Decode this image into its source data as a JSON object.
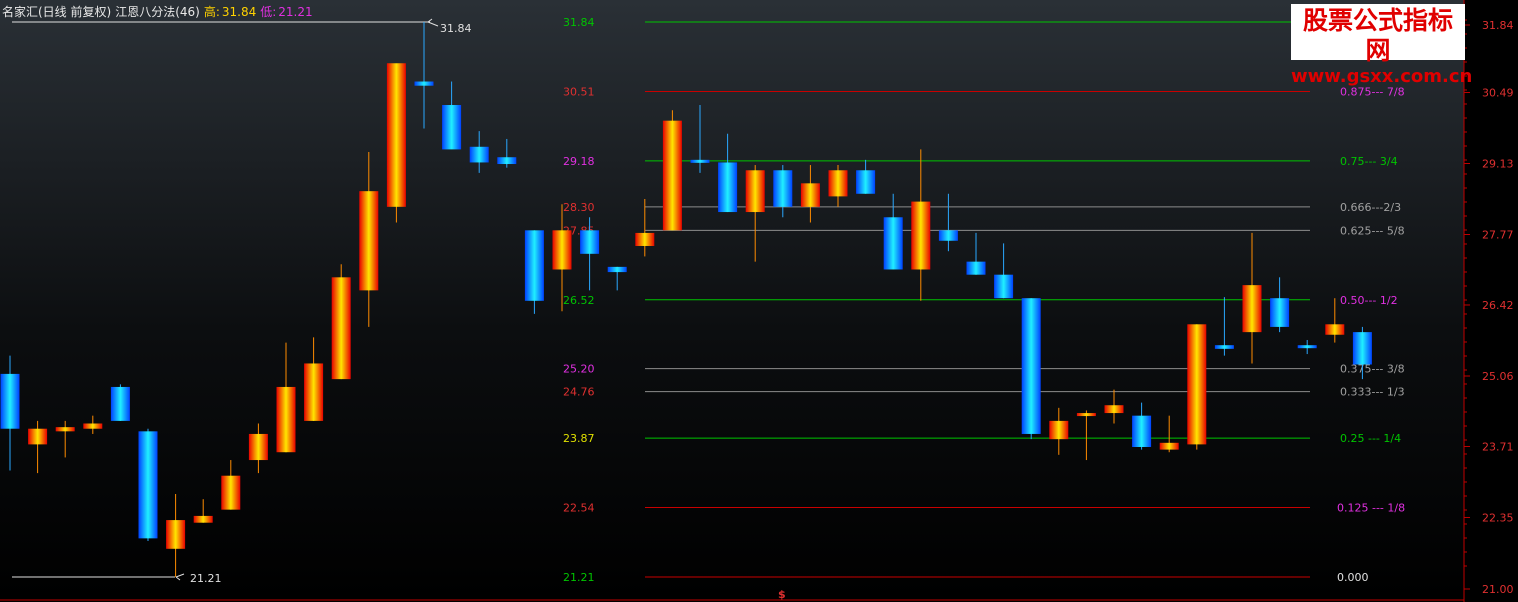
{
  "header": {
    "stock_name": "名家汇(日线 前复权)",
    "indicator": "江恩八分法(46)",
    "high_label": "高:",
    "high_value": "31.84",
    "low_label": "低:",
    "low_value": "21.21"
  },
  "watermark": {
    "line1": "股票公式指标网",
    "line2": "www.gsxx.com.cn"
  },
  "colors": {
    "background": "#000000",
    "up_candle": "#ff3a00",
    "down_candle": "#00a8ff",
    "green_level": "#00c400",
    "red_level": "#c80000",
    "gray_level": "#8c8c8c",
    "magenta_text": "#e030e0",
    "right_axis": "#c00000"
  },
  "chart_data": {
    "type": "candlestick",
    "title": "",
    "ylim": [
      21.0,
      31.84
    ],
    "y_axis_ticks": [
      "31.84",
      "30.49",
      "29.13",
      "27.77",
      "26.42",
      "25.06",
      "23.71",
      "22.35",
      "21.00"
    ],
    "y_axis_tick_values": [
      31.84,
      30.49,
      29.13,
      27.77,
      26.42,
      25.06,
      23.71,
      22.35,
      21.0
    ],
    "annotations": {
      "high": "31.84",
      "low": "21.21",
      "marker": "$"
    },
    "levels": [
      {
        "price": 31.84,
        "price_label": "31.84",
        "ratio_label": "",
        "color": "green",
        "style": "white_top"
      },
      {
        "price": 30.51,
        "price_label": "30.51",
        "ratio_label": "0.875--- 7/8",
        "color": "red"
      },
      {
        "price": 29.18,
        "price_label": "29.18",
        "ratio_label": "0.75--- 3/4",
        "color": "green"
      },
      {
        "price": 28.3,
        "price_label": "28.30",
        "ratio_label": "0.666---2/3",
        "color": "gray"
      },
      {
        "price": 27.85,
        "price_label": "27.85",
        "ratio_label": "0.625--- 5/8",
        "color": "gray"
      },
      {
        "price": 26.52,
        "price_label": "26.52",
        "ratio_label": "0.50--- 1/2",
        "color": "green"
      },
      {
        "price": 25.2,
        "price_label": "25.20",
        "ratio_label": "0.375--- 3/8",
        "color": "gray"
      },
      {
        "price": 24.76,
        "price_label": "24.76",
        "ratio_label": "0.333--- 1/3",
        "color": "gray"
      },
      {
        "price": 23.87,
        "price_label": "23.87",
        "ratio_label": "0.25 --- 1/4",
        "color": "green"
      },
      {
        "price": 22.54,
        "price_label": "22.54",
        "ratio_label": "0.125 --- 1/8",
        "color": "red"
      },
      {
        "price": 21.21,
        "price_label": "21.21",
        "ratio_label": "0.000",
        "color": "red"
      }
    ],
    "candles": [
      {
        "o": 25.1,
        "h": 25.45,
        "l": 23.25,
        "c": 24.05
      },
      {
        "o": 23.75,
        "h": 24.2,
        "l": 23.2,
        "c": 24.05
      },
      {
        "o": 24.0,
        "h": 24.2,
        "l": 23.5,
        "c": 24.08
      },
      {
        "o": 24.05,
        "h": 24.3,
        "l": 23.95,
        "c": 24.15
      },
      {
        "o": 24.85,
        "h": 24.9,
        "l": 24.2,
        "c": 24.2
      },
      {
        "o": 24.0,
        "h": 24.05,
        "l": 21.9,
        "c": 21.95
      },
      {
        "o": 21.75,
        "h": 22.8,
        "l": 21.21,
        "c": 22.3
      },
      {
        "o": 22.25,
        "h": 22.7,
        "l": 22.25,
        "c": 22.38
      },
      {
        "o": 22.5,
        "h": 23.45,
        "l": 22.5,
        "c": 23.15
      },
      {
        "o": 23.45,
        "h": 24.15,
        "l": 23.2,
        "c": 23.95
      },
      {
        "o": 23.6,
        "h": 25.7,
        "l": 23.6,
        "c": 24.85
      },
      {
        "o": 24.2,
        "h": 25.8,
        "l": 24.2,
        "c": 25.3
      },
      {
        "o": 25.0,
        "h": 27.2,
        "l": 25.0,
        "c": 26.95
      },
      {
        "o": 26.7,
        "h": 29.35,
        "l": 26.0,
        "c": 28.6
      },
      {
        "o": 28.3,
        "h": 31.0,
        "l": 28.0,
        "c": 31.05
      },
      {
        "o": 30.7,
        "h": 31.84,
        "l": 29.8,
        "c": 30.62
      },
      {
        "o": 30.25,
        "h": 30.7,
        "l": 29.65,
        "c": 29.4
      },
      {
        "o": 29.45,
        "h": 29.75,
        "l": 28.95,
        "c": 29.15
      },
      {
        "o": 29.25,
        "h": 29.6,
        "l": 29.05,
        "c": 29.12
      },
      {
        "o": 27.85,
        "h": 27.85,
        "l": 26.25,
        "c": 26.5
      },
      {
        "o": 27.1,
        "h": 28.35,
        "l": 26.3,
        "c": 27.85
      },
      {
        "o": 27.85,
        "h": 28.1,
        "l": 26.7,
        "c": 27.4
      },
      {
        "o": 27.15,
        "h": 27.15,
        "l": 26.7,
        "c": 27.05
      },
      {
        "o": 27.55,
        "h": 28.45,
        "l": 27.35,
        "c": 27.8
      },
      {
        "o": 27.85,
        "h": 30.15,
        "l": 27.85,
        "c": 29.95
      },
      {
        "o": 29.2,
        "h": 30.25,
        "l": 28.95,
        "c": 29.15
      },
      {
        "o": 29.15,
        "h": 29.7,
        "l": 28.2,
        "c": 28.2
      },
      {
        "o": 28.2,
        "h": 29.1,
        "l": 27.25,
        "c": 29.0
      },
      {
        "o": 29.0,
        "h": 29.1,
        "l": 28.1,
        "c": 28.3
      },
      {
        "o": 28.3,
        "h": 29.1,
        "l": 28.0,
        "c": 28.75
      },
      {
        "o": 28.5,
        "h": 29.1,
        "l": 28.3,
        "c": 29.0
      },
      {
        "o": 29.0,
        "h": 29.2,
        "l": 28.55,
        "c": 28.55
      },
      {
        "o": 28.1,
        "h": 28.55,
        "l": 27.1,
        "c": 27.1
      },
      {
        "o": 27.1,
        "h": 29.4,
        "l": 26.5,
        "c": 28.4
      },
      {
        "o": 27.85,
        "h": 28.55,
        "l": 27.45,
        "c": 27.65
      },
      {
        "o": 27.25,
        "h": 27.8,
        "l": 27.0,
        "c": 27.0
      },
      {
        "o": 27.0,
        "h": 27.6,
        "l": 26.55,
        "c": 26.55
      },
      {
        "o": 26.55,
        "h": 26.55,
        "l": 23.85,
        "c": 23.95
      },
      {
        "o": 23.85,
        "h": 24.45,
        "l": 23.55,
        "c": 24.2
      },
      {
        "o": 24.3,
        "h": 24.4,
        "l": 23.45,
        "c": 24.35
      },
      {
        "o": 24.35,
        "h": 24.8,
        "l": 24.15,
        "c": 24.5
      },
      {
        "o": 24.3,
        "h": 24.55,
        "l": 23.65,
        "c": 23.7
      },
      {
        "o": 23.65,
        "h": 24.3,
        "l": 23.6,
        "c": 23.78
      },
      {
        "o": 23.75,
        "h": 26.05,
        "l": 23.65,
        "c": 26.05
      },
      {
        "o": 25.65,
        "h": 26.57,
        "l": 25.45,
        "c": 25.58
      },
      {
        "o": 25.9,
        "h": 27.8,
        "l": 25.3,
        "c": 26.8
      },
      {
        "o": 26.55,
        "h": 26.95,
        "l": 25.9,
        "c": 26.0
      },
      {
        "o": 25.65,
        "h": 25.75,
        "l": 25.48,
        "c": 25.6
      },
      {
        "o": 25.85,
        "h": 26.55,
        "l": 25.7,
        "c": 26.05
      },
      {
        "o": 25.9,
        "h": 26.0,
        "l": 25.0,
        "c": 25.28
      }
    ]
  }
}
